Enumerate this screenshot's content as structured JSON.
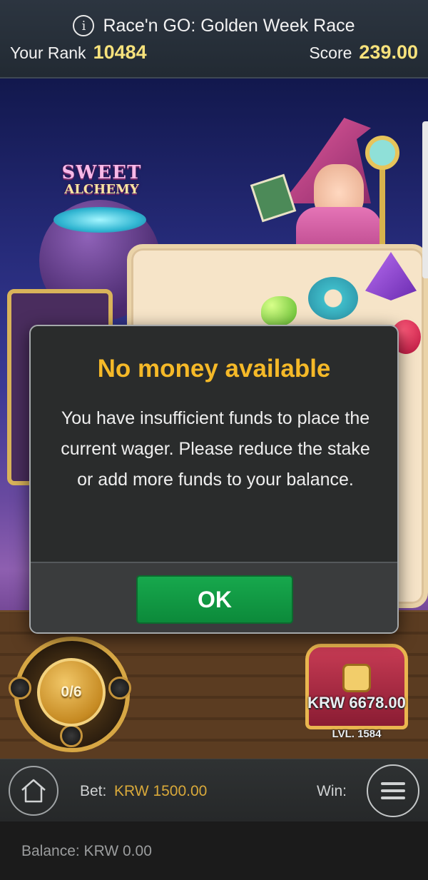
{
  "race": {
    "title": "Race'n GO: Golden Week Race",
    "rank_label": "Your Rank",
    "rank_value": "10484",
    "score_label": "Score",
    "score_value": "239.00",
    "info_icon": "info-icon"
  },
  "game": {
    "logo_line1": "SWEET",
    "logo_line2": "ALCHEMY",
    "free_spins_counter": "0/6",
    "chest_amount": "KRW 6678.00",
    "chest_level": "LVL. 1584"
  },
  "modal": {
    "title": "No money available",
    "message": "You have insufficient funds to place the current wager. Please reduce the stake or add more funds to your balance.",
    "ok_label": "OK"
  },
  "bottom": {
    "home_icon": "home-icon",
    "bet_label": "Bet:",
    "bet_value": "KRW 1500.00",
    "win_label": "Win:",
    "menu_icon": "hamburger-menu-icon",
    "balance_text": "Balance: KRW 0.00"
  },
  "colors": {
    "accent_yellow": "#f7e27c",
    "modal_title": "#f5b928",
    "ok_green": "#17a84d",
    "bet_gold": "#d9a93a"
  }
}
